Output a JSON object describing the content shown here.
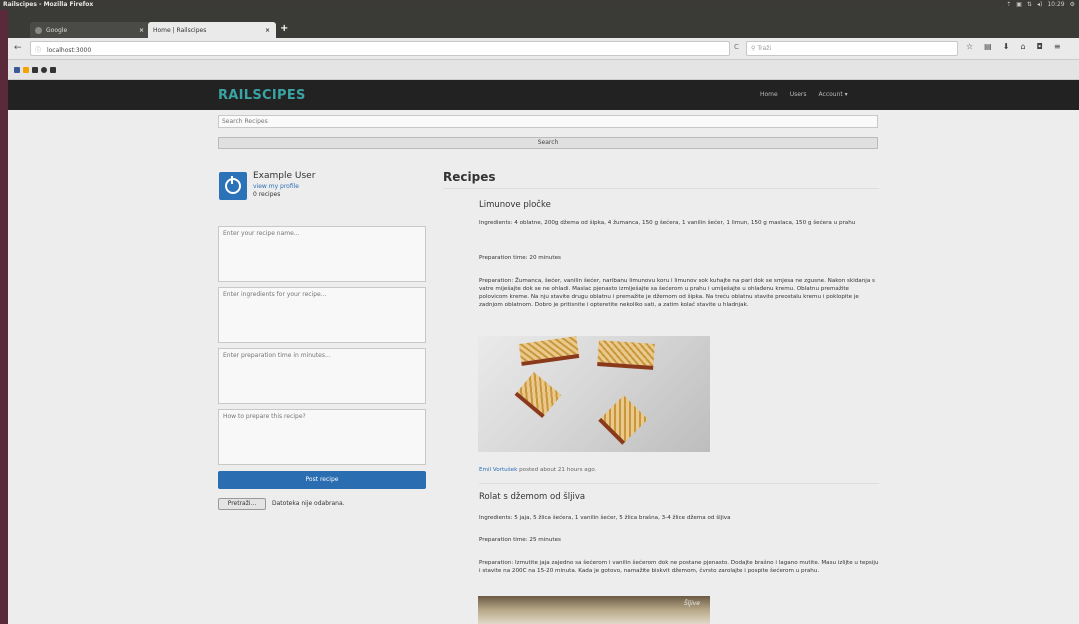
{
  "os": {
    "window_title": "Railscipes - Mozilla Firefox",
    "tray": [
      "⇡",
      "▣",
      "⇅",
      "◂)",
      "10:29",
      "⚙"
    ]
  },
  "tabs": [
    {
      "label": "Google",
      "close": "×"
    },
    {
      "label": "Home | Railscipes",
      "close": "×"
    }
  ],
  "new_tab": "+",
  "nav": {
    "back": "←",
    "url": "localhost:3000",
    "reload": "C",
    "search_placeholder": "Traži"
  },
  "bookmarks": [
    {
      "color": "#3b5998"
    },
    {
      "color": "#f4a300"
    },
    {
      "color": "#333333"
    },
    {
      "color": "#333333"
    },
    {
      "color": "#333333"
    }
  ],
  "site": {
    "brand": "RAILSCIPES",
    "links": [
      "Home",
      "Users",
      "Account ▾"
    ],
    "search_placeholder": "Search Recipes",
    "search_button": "Search"
  },
  "user": {
    "name": "Example User",
    "profile_link": "view my profile",
    "recipe_count": "0 recipes"
  },
  "form": {
    "name_placeholder": "Enter your recipe name...",
    "ingredients_placeholder": "Enter ingredients for your recipe...",
    "prep_placeholder": "Enter preparation time in minutes...",
    "method_placeholder": "How to prepare this recipe?",
    "post_button": "Post recipe",
    "file_button": "Pretraži...",
    "file_label": "Datoteka nije odabrana."
  },
  "feed": {
    "title": "Recipes",
    "recipes": [
      {
        "title": "Limunove pločke",
        "ingredients": "Ingredients: 4 oblatne, 200g džema od šipka, 4 žumanca, 150 g šećera, 1 vanilin šećer, 1 limun, 150 g maslaca, 150 g šećera u prahu",
        "prep_time": "Preparation time: 20 minutes",
        "preparation": "Preparation: Žumanca, šećer, vanilin šećer, naribanu limunovu koru i limunov sok kuhajte na pari dok se smjesa ne zgusne. Nakon skidanja s vatre miješajte dok se ne ohladi. Maslac pjenasto izmiješajte sa šećerom u prahu i umiješajte u ohlađenu kremu. Oblatnu premažite polovicom kreme. Na nju stavite drugu oblatnu i premažite je džemom od šipka. Na treću oblatnu stavite preostalu kremu i poklopite je zadnjom oblatnom. Dobro je pritisnite i opteretite nekoliko sati, a zatim kolač stavite u hladnjak.",
        "author": "Emil Vortušek",
        "posted": " posted about 21 hours ago."
      },
      {
        "title": "Rolat s džemom od šljiva",
        "ingredients": "Ingredients: 5 jaja, 5 žlica šećera, 1 vanilin šećer, 5 žlica brašna, 3-4 žlice džema od šljiva",
        "prep_time": "Preparation time: 25 minutes",
        "preparation": "Preparation: Izmutite jaja zajedno sa šećerom i vanilin šećerom dok ne postane pjenasto. Dodajte brašno i lagano mutite. Masu izlijte u tepsiju i stavite na 200C na 15-20 minuta. Kada je gotovo, namažite biskvit džemom, čvrsto zarolajte i pospite šećerom u prahu.",
        "photo_signature": "Šljive"
      }
    ]
  }
}
